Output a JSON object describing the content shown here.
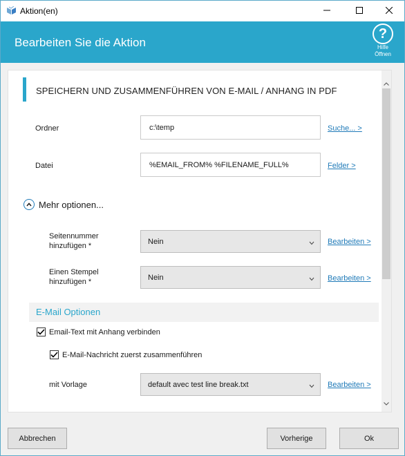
{
  "window": {
    "title": "Aktion(en)"
  },
  "header": {
    "title": "Bearbeiten Sie die Aktion",
    "help_label_1": "Hilfe",
    "help_label_2": "Öffnen"
  },
  "section": {
    "title": "SPEICHERN UND ZUSAMMENFÜHREN VON E-MAIL / ANHANG IN PDF"
  },
  "fields": {
    "folder": {
      "label": "Ordner",
      "value": "c:\\temp",
      "link": "Suche... >"
    },
    "file": {
      "label": "Datei",
      "value": "%EMAIL_FROM% %FILENAME_FULL%",
      "link": "Felder >"
    }
  },
  "more_options": {
    "label": "Mehr optionen..."
  },
  "options": {
    "page_number": {
      "label_1": "Seitennummer",
      "label_2": "hinzufügen *",
      "value": "Nein",
      "link": "Bearbeiten >"
    },
    "stamp": {
      "label_1": "Einen Stempel",
      "label_2": "hinzufügen *",
      "value": "Nein",
      "link": "Bearbeiten >"
    }
  },
  "email_options": {
    "title": "E-Mail Optionen",
    "merge_text": {
      "label": "Email-Text mit Anhang verbinden",
      "checked": true
    },
    "merge_first": {
      "label": "E-Mail-Nachricht zuerst zusammenführen",
      "checked": true
    },
    "template": {
      "label": "mit Vorlage",
      "value": "default avec test line break.txt",
      "link": "Bearbeiten >"
    }
  },
  "buttons": {
    "cancel": "Abbrechen",
    "previous": "Vorherige",
    "ok": "Ok"
  },
  "colors": {
    "accent": "#2aa6cb",
    "link": "#1f7ab8"
  }
}
